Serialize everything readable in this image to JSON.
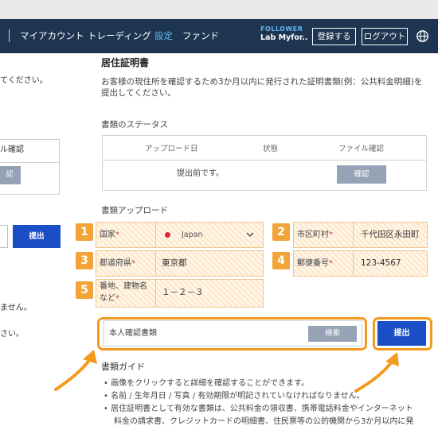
{
  "nav": {
    "links": [
      "マイアカウント",
      "トレーディング",
      "設定",
      "ファンド"
    ],
    "brand_top": "FOLLOWER",
    "brand_bottom": "Lab Myfor..",
    "register": "登録する",
    "logout": "ログアウト",
    "icon": "globe-icon"
  },
  "left_fragments": {
    "text1": "てください。",
    "text2": "ル確認",
    "btn": "認",
    "submit": "提出",
    "text3": "ません。",
    "text4": "さい。"
  },
  "section": {
    "title": "居住証明書",
    "description": "お客様の現住所を確認するため3か月以内に発行された証明書類(例：公共料金明細)を提出してください。"
  },
  "status": {
    "label": "書類のステータス",
    "headers": [
      "アップロード日",
      "状態",
      "ファイル確認"
    ],
    "cell": "提出前です。",
    "confirm": "確認"
  },
  "upload": {
    "label": "書類アップロード",
    "fields": [
      {
        "num": "1",
        "label": "国家",
        "value": "Japan"
      },
      {
        "num": "2",
        "label": "市区町村",
        "value": "千代田区永田町"
      },
      {
        "num": "3",
        "label": "都道府県",
        "value": "東京都"
      },
      {
        "num": "4",
        "label": "郵便番号",
        "value": "123-4567"
      },
      {
        "num": "5",
        "label_line1": "番地、建物名",
        "label_line2": "など",
        "value": "１－２－３"
      }
    ],
    "required_mark": "*",
    "file_text": "本人確認書類",
    "browse": "検索",
    "submit": "提出"
  },
  "guide": {
    "title": "書類ガイド",
    "bullets": [
      "• 画像をクリックすると詳細を確認することができます。",
      "• 名前 / 生年月日 / 写真 / 有効期限が明記されていなければなりません。",
      "• 居住証明書として有効な書類は、公共料金の領収書、携帯電話料金やインターネット",
      "料金の請求書、クレジットカードの明細書、住民票等の公的機関から3か月以内に発"
    ]
  },
  "colors": {
    "navbar": "#1d3550",
    "accent": "#f39a1f",
    "primary": "#1b4ec6",
    "active_link": "#5fb8ee"
  }
}
